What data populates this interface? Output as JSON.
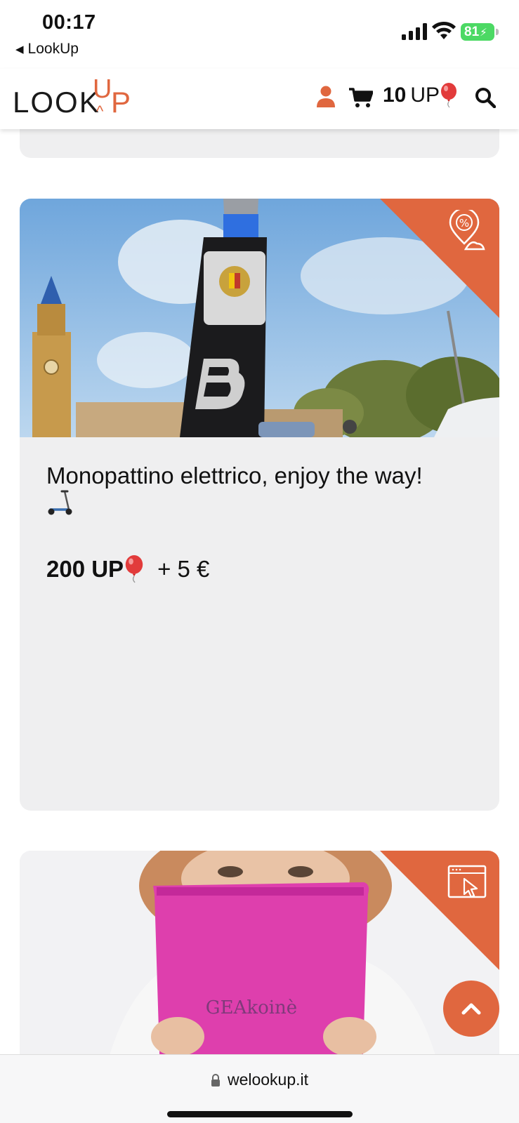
{
  "status_bar": {
    "time": "00:17",
    "back_app": "LookUp",
    "battery": "81"
  },
  "header": {
    "logo_look": "LOOK",
    "logo_u": "U",
    "logo_p": "P",
    "points_value": "10",
    "points_unit": "UP",
    "icons": [
      "user-icon",
      "cart-icon",
      "balloon-icon",
      "search-icon"
    ]
  },
  "cards": [
    {
      "image_alt": "Electric scooter handlebar in Bergamo",
      "badge_icon": "location-discount-icon",
      "title": "Monopattino elettrico, enjoy the way!",
      "price_up": "200 UP",
      "price_extra": "+ 5 €"
    },
    {
      "image_alt": "Woman holding a pink GEAkoinè book",
      "badge_icon": "web-click-icon",
      "image_text": "GEAkoinè"
    }
  ],
  "browser": {
    "url": "welookup.it"
  },
  "colors": {
    "accent": "#e0673f",
    "card_bg": "#efeff0",
    "battery": "#4cd964"
  }
}
